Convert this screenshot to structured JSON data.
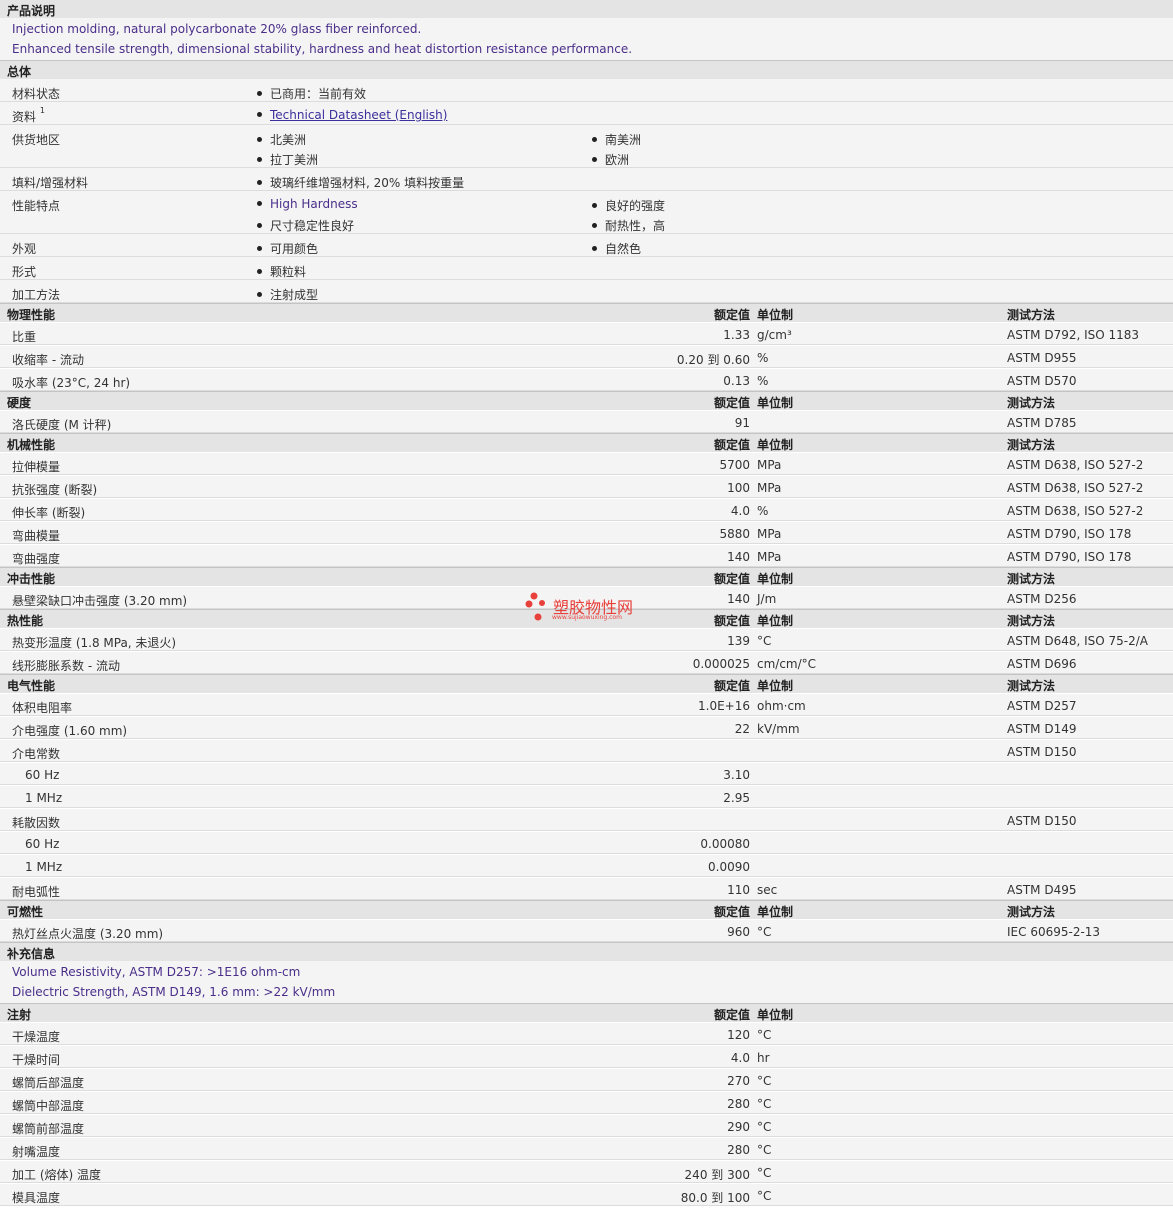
{
  "desc": {
    "title": "产品说明",
    "lines": [
      "Injection molding, natural polycarbonate 20% glass fiber reinforced.",
      "Enhanced tensile strength, dimensional stability, hardness and heat distortion resistance performance."
    ]
  },
  "general": {
    "title": "总体",
    "rows": [
      {
        "name": "材料状态",
        "col1": [
          "已商用：当前有效"
        ],
        "col2": []
      },
      {
        "name": "资料",
        "sup": "1",
        "col1": [
          "Technical Datasheet (English)"
        ],
        "col2": []
      },
      {
        "name": "供货地区",
        "col1": [
          "北美洲",
          "拉丁美洲"
        ],
        "col2": [
          "南美洲",
          "欧洲"
        ]
      },
      {
        "name": "填料/增强材料",
        "col1": [
          "玻璃纤维增强材料, 20% 填料按重量"
        ],
        "col2": []
      },
      {
        "name": "性能特点",
        "col1": [
          "High Hardness",
          "尺寸稳定性良好"
        ],
        "col2": [
          "良好的强度",
          "耐热性，高"
        ]
      },
      {
        "name": "外观",
        "col1": [
          "可用颜色"
        ],
        "col2": [
          "自然色"
        ]
      },
      {
        "name": "形式",
        "col1": [
          "颗粒料"
        ],
        "col2": []
      },
      {
        "name": "加工方法",
        "col1": [
          "注射成型"
        ],
        "col2": []
      }
    ]
  },
  "col_headers": {
    "value": "额定值",
    "unit": "单位制",
    "method": "测试方法"
  },
  "physical": {
    "title": "物理性能",
    "rows": [
      {
        "name": "比重",
        "value": "1.33",
        "unit": "g/cm³",
        "method": "ASTM D792, ISO 1183"
      },
      {
        "name": "收缩率 - 流动",
        "value": "0.20 到  0.60",
        "unit": "%",
        "method": "ASTM D955"
      },
      {
        "name": "吸水率 (23°C, 24 hr)",
        "value": "0.13",
        "unit": "%",
        "method": "ASTM D570"
      }
    ]
  },
  "hardness": {
    "title": "硬度",
    "rows": [
      {
        "name": "洛氏硬度 (M 计秤)",
        "value": "91",
        "unit": "",
        "method": "ASTM D785"
      }
    ]
  },
  "mechanical": {
    "title": "机械性能",
    "rows": [
      {
        "name": "拉伸模量",
        "value": "5700",
        "unit": "MPa",
        "method": "ASTM D638, ISO 527-2"
      },
      {
        "name": "抗张强度 (断裂)",
        "value": "100",
        "unit": "MPa",
        "method": "ASTM D638, ISO 527-2"
      },
      {
        "name": "伸长率 (断裂)",
        "value": "4.0",
        "unit": "%",
        "method": "ASTM D638, ISO 527-2"
      },
      {
        "name": "弯曲模量",
        "value": "5880",
        "unit": "MPa",
        "method": "ASTM D790, ISO 178"
      },
      {
        "name": "弯曲强度",
        "value": "140",
        "unit": "MPa",
        "method": "ASTM D790, ISO 178"
      }
    ]
  },
  "impact": {
    "title": "冲击性能",
    "rows": [
      {
        "name": "悬壁梁缺口冲击强度 (3.20 mm)",
        "value": "140",
        "unit": "J/m",
        "method": "ASTM D256"
      }
    ]
  },
  "thermal": {
    "title": "热性能",
    "rows": [
      {
        "name": "热变形温度 (1.8 MPa, 未退火)",
        "value": "139",
        "unit": "°C",
        "method": "ASTM D648, ISO 75-2/A"
      },
      {
        "name": "线形膨胀系数 - 流动",
        "value": "0.000025",
        "unit": "cm/cm/°C",
        "method": "ASTM D696"
      }
    ]
  },
  "electrical": {
    "title": "电气性能",
    "rows": [
      {
        "name": "体积电阻率",
        "value": "1.0E+16",
        "unit": "ohm·cm",
        "method": "ASTM D257"
      },
      {
        "name": "介电强度 (1.60 mm)",
        "value": "22",
        "unit": "kV/mm",
        "method": "ASTM D149"
      },
      {
        "name": "介电常数",
        "value": "",
        "unit": "",
        "method": "ASTM D150"
      },
      {
        "name": "60 Hz",
        "sub": true,
        "value": "3.10",
        "unit": "",
        "method": ""
      },
      {
        "name": "1 MHz",
        "sub": true,
        "value": "2.95",
        "unit": "",
        "method": ""
      },
      {
        "name": "耗散因数",
        "value": "",
        "unit": "",
        "method": "ASTM D150"
      },
      {
        "name": "60 Hz",
        "sub": true,
        "value": "0.00080",
        "unit": "",
        "method": ""
      },
      {
        "name": "1 MHz",
        "sub": true,
        "value": "0.0090",
        "unit": "",
        "method": ""
      },
      {
        "name": "耐电弧性",
        "value": "110",
        "unit": "sec",
        "method": "ASTM D495"
      }
    ]
  },
  "flammability": {
    "title": "可燃性",
    "rows": [
      {
        "name": "热灯丝点火温度 (3.20 mm)",
        "value": "960",
        "unit": "°C",
        "method": "IEC 60695-2-13"
      }
    ]
  },
  "supplement": {
    "title": "补充信息",
    "lines": [
      "Volume Resistivity, ASTM D257: >1E16 ohm-cm",
      "Dielectric Strength, ASTM D149, 1.6 mm: >22 kV/mm"
    ]
  },
  "injection": {
    "title": "注射",
    "rows": [
      {
        "name": "干燥温度",
        "value": "120",
        "unit": "°C",
        "method": ""
      },
      {
        "name": "干燥时间",
        "value": "4.0",
        "unit": "hr",
        "method": ""
      },
      {
        "name": "螺筒后部温度",
        "value": "270",
        "unit": "°C",
        "method": ""
      },
      {
        "name": "螺筒中部温度",
        "value": "280",
        "unit": "°C",
        "method": ""
      },
      {
        "name": "螺筒前部温度",
        "value": "290",
        "unit": "°C",
        "method": ""
      },
      {
        "name": "射嘴温度",
        "value": "280",
        "unit": "°C",
        "method": ""
      },
      {
        "name": "加工 (熔体) 温度",
        "value": "240 到  300",
        "unit": "°C",
        "method": ""
      },
      {
        "name": "模具温度",
        "value": "80.0 到  100",
        "unit": "°C",
        "method": ""
      }
    ]
  },
  "watermark": {
    "text": "塑胶物性网",
    "url": "www.sujiaowuxing.com",
    "color": "#e8413b"
  }
}
